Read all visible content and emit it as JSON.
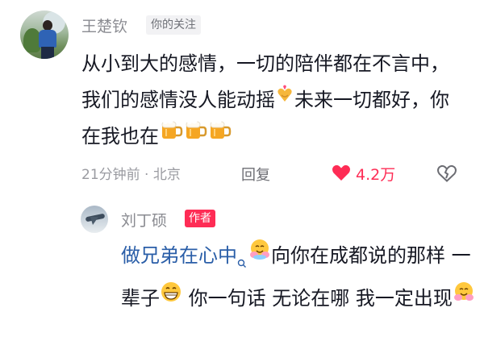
{
  "comment": {
    "username": "王楚钦",
    "follow_badge": "你的关注",
    "text_parts": [
      "从小到大的感情，一切的陪伴都在不言中，我们的感情没人能动摇",
      "未来一切都好，你在我也在"
    ],
    "time_location": "21分钟前 · 北京",
    "reply_label": "回复",
    "like_count": "4.2万"
  },
  "reply": {
    "username": "刘丁硕",
    "author_badge": "作者",
    "highlight_text": "做兄弟在心中",
    "text_part2": "向你在成都说的那样 一辈子",
    "text_part3": " 你一句话 无论在哪 我一定出现"
  },
  "colors": {
    "accent": "#fe2c55",
    "link": "#2a5ea8",
    "muted": "#8a8b91"
  },
  "icons": [
    "heart-hands-emoji",
    "beer-mug-emoji",
    "heart-filled-icon",
    "broken-heart-icon",
    "search-icon",
    "hug-emoji",
    "grin-emoji"
  ]
}
